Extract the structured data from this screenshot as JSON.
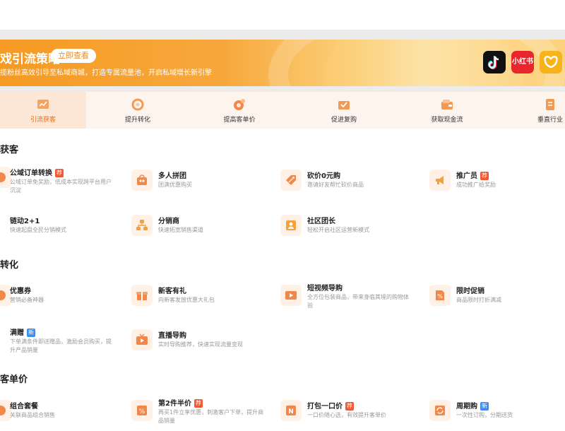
{
  "banner": {
    "title": "戏引流策略",
    "cta": "立即查看",
    "subtitle": "揽粉丝高效引导至私域商城，打造专属流量池，开启私域增长新引擎"
  },
  "apps": [
    {
      "name": "tiktok-icon"
    },
    {
      "name": "xiaohongshu-icon",
      "label": "小红书"
    },
    {
      "name": "butterfly-icon"
    }
  ],
  "tabs": [
    {
      "label": "引流获客",
      "active": true
    },
    {
      "label": "提升转化"
    },
    {
      "label": "提高客单价"
    },
    {
      "label": "促进复购"
    },
    {
      "label": "获取现金流"
    },
    {
      "label": "垂直行业"
    }
  ],
  "sections": [
    {
      "title": "获客",
      "items": [
        {
          "name": "公域订单转换",
          "tag": "荐",
          "desc": "公域订单免奖励，低成本实现跨平台用户沉淀"
        },
        {
          "name": "多人拼团",
          "desc": "团满优惠购买"
        },
        {
          "name": "砍价0元购",
          "desc": "邀请好友帮忙砍价商品"
        },
        {
          "name": "推广员",
          "tag": "荐",
          "desc": "成功推广给奖励"
        },
        {
          "name": "链动2+1",
          "desc": "快速起盘全民分销模式"
        },
        {
          "name": "分销商",
          "desc": "快速拓宽销售渠道"
        },
        {
          "name": "社区团长",
          "desc": "轻松开启社区运营新模式"
        }
      ]
    },
    {
      "title": "转化",
      "items": [
        {
          "name": "优惠券",
          "desc": "营销必备神器"
        },
        {
          "name": "新客有礼",
          "desc": "向新客发放优惠大礼包"
        },
        {
          "name": "短视频导购",
          "desc": "全方位包装商品，带来身临其境的购物体验"
        },
        {
          "name": "限时促销",
          "desc": "商品限时打折满减"
        },
        {
          "name": "满赠",
          "tag": "新",
          "desc": "下单满条件即送赠品，激励会员购买，提升产品销量"
        },
        {
          "name": "直播导购",
          "desc": "实时导购推荐，快速实现流量变现"
        }
      ]
    },
    {
      "title": "客单价",
      "items": [
        {
          "name": "组合套餐",
          "desc": "关联商品组合销售"
        },
        {
          "name": "第2件半价",
          "tag": "荐",
          "desc": "再买1件立享优惠，刺激客户下单，提升商品销量"
        },
        {
          "name": "打包一口价",
          "tag": "荐",
          "desc": "一口价随心选，有效提升客单价"
        },
        {
          "name": "周期购",
          "tag": "新",
          "desc": "一次性订购，分期送货"
        }
      ]
    }
  ],
  "colors": {
    "accent": "#ec6a12",
    "banner": "#f59a23",
    "tag_hot": "#ef5a35",
    "tag_new": "#3b8cf5"
  }
}
